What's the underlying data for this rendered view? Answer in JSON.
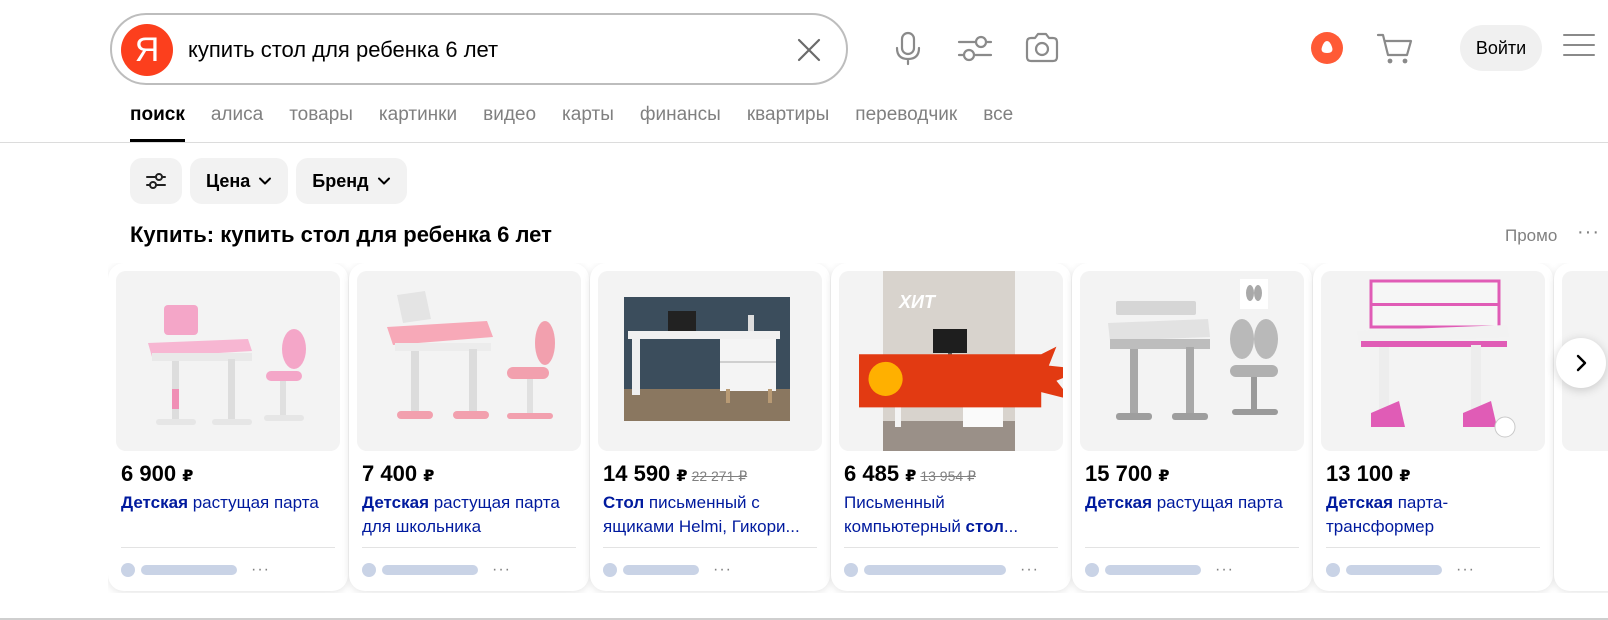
{
  "search": {
    "logo": "Я",
    "query": "купить стол для ребенка 6 лет"
  },
  "header": {
    "login_label": "Войти",
    "icons": [
      "microphone-icon",
      "filters-icon",
      "camera-icon",
      "alice-icon",
      "cart-icon",
      "menu-icon"
    ]
  },
  "tabs": [
    {
      "label": "поиск",
      "active": true
    },
    {
      "label": "алиса"
    },
    {
      "label": "товары"
    },
    {
      "label": "картинки"
    },
    {
      "label": "видео"
    },
    {
      "label": "карты"
    },
    {
      "label": "финансы"
    },
    {
      "label": "квартиры"
    },
    {
      "label": "переводчик"
    },
    {
      "label": "все"
    }
  ],
  "filters": [
    {
      "label": "Цена"
    },
    {
      "label": "Бренд"
    }
  ],
  "section": {
    "title": "Купить: купить стол для ребенка 6 лет",
    "promo_label": "Промо",
    "more": "···"
  },
  "cards": [
    {
      "price": "6 900",
      "currency": "₽",
      "old_price": "",
      "title_bold": "Детская",
      "title_rest": " растущая парта",
      "image": "pink-school-desk-with-chair"
    },
    {
      "price": "7 400",
      "currency": "₽",
      "old_price": "",
      "title_bold": "Детская",
      "title_rest": " растущая парта для школьника",
      "image": "pink-desk-with-bookstand-and-chair"
    },
    {
      "price": "14 590",
      "currency": "₽",
      "old_price": "22 271 ₽",
      "title_bold": "Стол",
      "title_rest": " письменный с ящиками Helmi, Гикори...",
      "image": "white-writing-desk-in-room"
    },
    {
      "price": "6 485",
      "currency": "₽",
      "old_price": "13 954 ₽",
      "title_pre": "Письменный компьютерный ",
      "title_bold": "стол",
      "title_rest": "...",
      "image": "white-computer-desk-hit-badge",
      "badge": "ХИТ"
    },
    {
      "price": "15 700",
      "currency": "₽",
      "old_price": "",
      "title_bold": "Детская",
      "title_rest": " растущая парта",
      "image": "grey-desk-with-ergonomic-chair"
    },
    {
      "price": "13 100",
      "currency": "₽",
      "old_price": "",
      "title_bold": "Детская",
      "title_rest": " парта-трансформер",
      "image": "pink-transformer-desk"
    }
  ]
}
